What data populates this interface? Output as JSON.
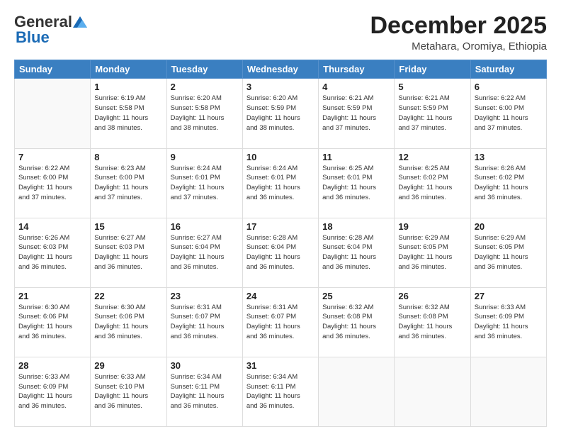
{
  "header": {
    "logo_general": "General",
    "logo_blue": "Blue",
    "month": "December 2025",
    "location": "Metahara, Oromiya, Ethiopia"
  },
  "days_of_week": [
    "Sunday",
    "Monday",
    "Tuesday",
    "Wednesday",
    "Thursday",
    "Friday",
    "Saturday"
  ],
  "weeks": [
    [
      {
        "day": "",
        "info": ""
      },
      {
        "day": "1",
        "info": "Sunrise: 6:19 AM\nSunset: 5:58 PM\nDaylight: 11 hours\nand 38 minutes."
      },
      {
        "day": "2",
        "info": "Sunrise: 6:20 AM\nSunset: 5:58 PM\nDaylight: 11 hours\nand 38 minutes."
      },
      {
        "day": "3",
        "info": "Sunrise: 6:20 AM\nSunset: 5:59 PM\nDaylight: 11 hours\nand 38 minutes."
      },
      {
        "day": "4",
        "info": "Sunrise: 6:21 AM\nSunset: 5:59 PM\nDaylight: 11 hours\nand 37 minutes."
      },
      {
        "day": "5",
        "info": "Sunrise: 6:21 AM\nSunset: 5:59 PM\nDaylight: 11 hours\nand 37 minutes."
      },
      {
        "day": "6",
        "info": "Sunrise: 6:22 AM\nSunset: 6:00 PM\nDaylight: 11 hours\nand 37 minutes."
      }
    ],
    [
      {
        "day": "7",
        "info": "Sunrise: 6:22 AM\nSunset: 6:00 PM\nDaylight: 11 hours\nand 37 minutes."
      },
      {
        "day": "8",
        "info": "Sunrise: 6:23 AM\nSunset: 6:00 PM\nDaylight: 11 hours\nand 37 minutes."
      },
      {
        "day": "9",
        "info": "Sunrise: 6:24 AM\nSunset: 6:01 PM\nDaylight: 11 hours\nand 37 minutes."
      },
      {
        "day": "10",
        "info": "Sunrise: 6:24 AM\nSunset: 6:01 PM\nDaylight: 11 hours\nand 36 minutes."
      },
      {
        "day": "11",
        "info": "Sunrise: 6:25 AM\nSunset: 6:01 PM\nDaylight: 11 hours\nand 36 minutes."
      },
      {
        "day": "12",
        "info": "Sunrise: 6:25 AM\nSunset: 6:02 PM\nDaylight: 11 hours\nand 36 minutes."
      },
      {
        "day": "13",
        "info": "Sunrise: 6:26 AM\nSunset: 6:02 PM\nDaylight: 11 hours\nand 36 minutes."
      }
    ],
    [
      {
        "day": "14",
        "info": "Sunrise: 6:26 AM\nSunset: 6:03 PM\nDaylight: 11 hours\nand 36 minutes."
      },
      {
        "day": "15",
        "info": "Sunrise: 6:27 AM\nSunset: 6:03 PM\nDaylight: 11 hours\nand 36 minutes."
      },
      {
        "day": "16",
        "info": "Sunrise: 6:27 AM\nSunset: 6:04 PM\nDaylight: 11 hours\nand 36 minutes."
      },
      {
        "day": "17",
        "info": "Sunrise: 6:28 AM\nSunset: 6:04 PM\nDaylight: 11 hours\nand 36 minutes."
      },
      {
        "day": "18",
        "info": "Sunrise: 6:28 AM\nSunset: 6:04 PM\nDaylight: 11 hours\nand 36 minutes."
      },
      {
        "day": "19",
        "info": "Sunrise: 6:29 AM\nSunset: 6:05 PM\nDaylight: 11 hours\nand 36 minutes."
      },
      {
        "day": "20",
        "info": "Sunrise: 6:29 AM\nSunset: 6:05 PM\nDaylight: 11 hours\nand 36 minutes."
      }
    ],
    [
      {
        "day": "21",
        "info": "Sunrise: 6:30 AM\nSunset: 6:06 PM\nDaylight: 11 hours\nand 36 minutes."
      },
      {
        "day": "22",
        "info": "Sunrise: 6:30 AM\nSunset: 6:06 PM\nDaylight: 11 hours\nand 36 minutes."
      },
      {
        "day": "23",
        "info": "Sunrise: 6:31 AM\nSunset: 6:07 PM\nDaylight: 11 hours\nand 36 minutes."
      },
      {
        "day": "24",
        "info": "Sunrise: 6:31 AM\nSunset: 6:07 PM\nDaylight: 11 hours\nand 36 minutes."
      },
      {
        "day": "25",
        "info": "Sunrise: 6:32 AM\nSunset: 6:08 PM\nDaylight: 11 hours\nand 36 minutes."
      },
      {
        "day": "26",
        "info": "Sunrise: 6:32 AM\nSunset: 6:08 PM\nDaylight: 11 hours\nand 36 minutes."
      },
      {
        "day": "27",
        "info": "Sunrise: 6:33 AM\nSunset: 6:09 PM\nDaylight: 11 hours\nand 36 minutes."
      }
    ],
    [
      {
        "day": "28",
        "info": "Sunrise: 6:33 AM\nSunset: 6:09 PM\nDaylight: 11 hours\nand 36 minutes."
      },
      {
        "day": "29",
        "info": "Sunrise: 6:33 AM\nSunset: 6:10 PM\nDaylight: 11 hours\nand 36 minutes."
      },
      {
        "day": "30",
        "info": "Sunrise: 6:34 AM\nSunset: 6:11 PM\nDaylight: 11 hours\nand 36 minutes."
      },
      {
        "day": "31",
        "info": "Sunrise: 6:34 AM\nSunset: 6:11 PM\nDaylight: 11 hours\nand 36 minutes."
      },
      {
        "day": "",
        "info": ""
      },
      {
        "day": "",
        "info": ""
      },
      {
        "day": "",
        "info": ""
      }
    ]
  ]
}
